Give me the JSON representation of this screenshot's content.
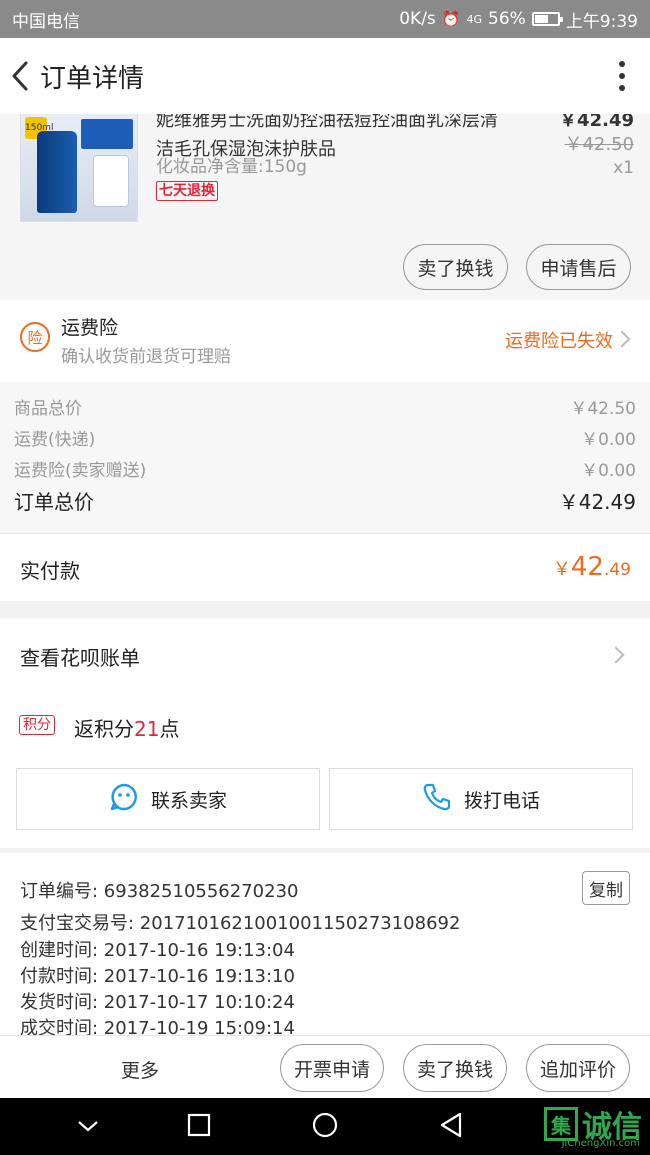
{
  "status_bar": {
    "carrier": "中国电信",
    "speed": "0K/s",
    "network": "4G",
    "battery": "56%",
    "battery_level": 0.56,
    "time": "上午9:39"
  },
  "header": {
    "title": "订单详情"
  },
  "product": {
    "title": "妮维雅男士洗面奶控油祛痘控油面乳深层清洁毛孔保湿泡沫护肤品",
    "title_line1": "妮维雅男士洗面奶控油祛痘控油面乳深层清",
    "title_line2": "洁毛孔保湿泡沫护肤品",
    "spec": "化妆品净含量:150g",
    "return_tag": "七天退换",
    "price_now": "￥42.49",
    "price_original": "￥42.50",
    "quantity": "x1",
    "buttons": {
      "sell_exchange": "卖了换钱",
      "after_sale": "申请售后"
    }
  },
  "insurance": {
    "icon_char": "险",
    "title": "运费险",
    "subtitle": "确认收货前退货可理赔",
    "status": "运费险已失效"
  },
  "pricing": {
    "rows": [
      {
        "label": "商品总价",
        "value": "￥42.50"
      },
      {
        "label": "运费(快递)",
        "value": "￥0.00"
      },
      {
        "label": "运费险(卖家赠送)",
        "value": "￥0.00"
      }
    ],
    "total_label": "订单总价",
    "total_value": "￥42.49"
  },
  "payment": {
    "label": "实付款",
    "currency": "￥",
    "amount_int": "42",
    "amount_dec": ".49"
  },
  "huabei": {
    "label": "查看花呗账单"
  },
  "points": {
    "tag": "积分",
    "prefix": "返积分",
    "count": "21",
    "suffix": "点"
  },
  "actions": {
    "contact_seller": "联系卖家",
    "call_phone": "拨打电话"
  },
  "order_info": {
    "copy_label": "复制",
    "rows": [
      "订单编号: 69382510556270230",
      "支付宝交易号: 2017101621001001150273108692",
      "创建时间: 2017-10-16 19:13:04",
      "付款时间: 2017-10-16 19:13:10",
      "发货时间: 2017-10-17 10:10:24",
      "成交时间: 2017-10-19 15:09:14"
    ]
  },
  "bottom_bar": {
    "more": "更多",
    "invoice": "开票申请",
    "sell_exchange": "卖了换钱",
    "add_review": "追加评价"
  },
  "watermark": {
    "box_char": "集",
    "text": "诚信",
    "sub": "JiChengXin.com"
  },
  "colors": {
    "accent_orange": "#f06a1f",
    "accent_red": "#e0283c",
    "watermark_green": "#2fa84f"
  }
}
